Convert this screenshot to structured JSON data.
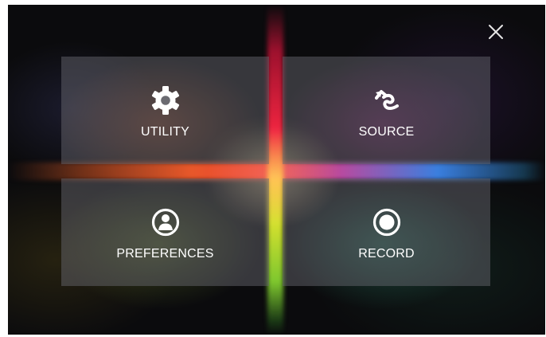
{
  "menu": {
    "close": {
      "icon": "close-icon"
    },
    "tiles": [
      {
        "label": "UTILITY",
        "icon": "gear-icon"
      },
      {
        "label": "SOURCE",
        "icon": "source-cable-icon"
      },
      {
        "label": "PREFERENCES",
        "icon": "user-circle-icon"
      },
      {
        "label": "RECORD",
        "icon": "record-icon"
      }
    ]
  },
  "colors": {
    "background": "#0b0b0d",
    "tile": "#69696f",
    "text": "#ffffff",
    "beam_red": "#ef2540",
    "beam_orange": "#e8582a",
    "beam_blue": "#3a7fdf",
    "beam_green": "#7ec72e"
  }
}
